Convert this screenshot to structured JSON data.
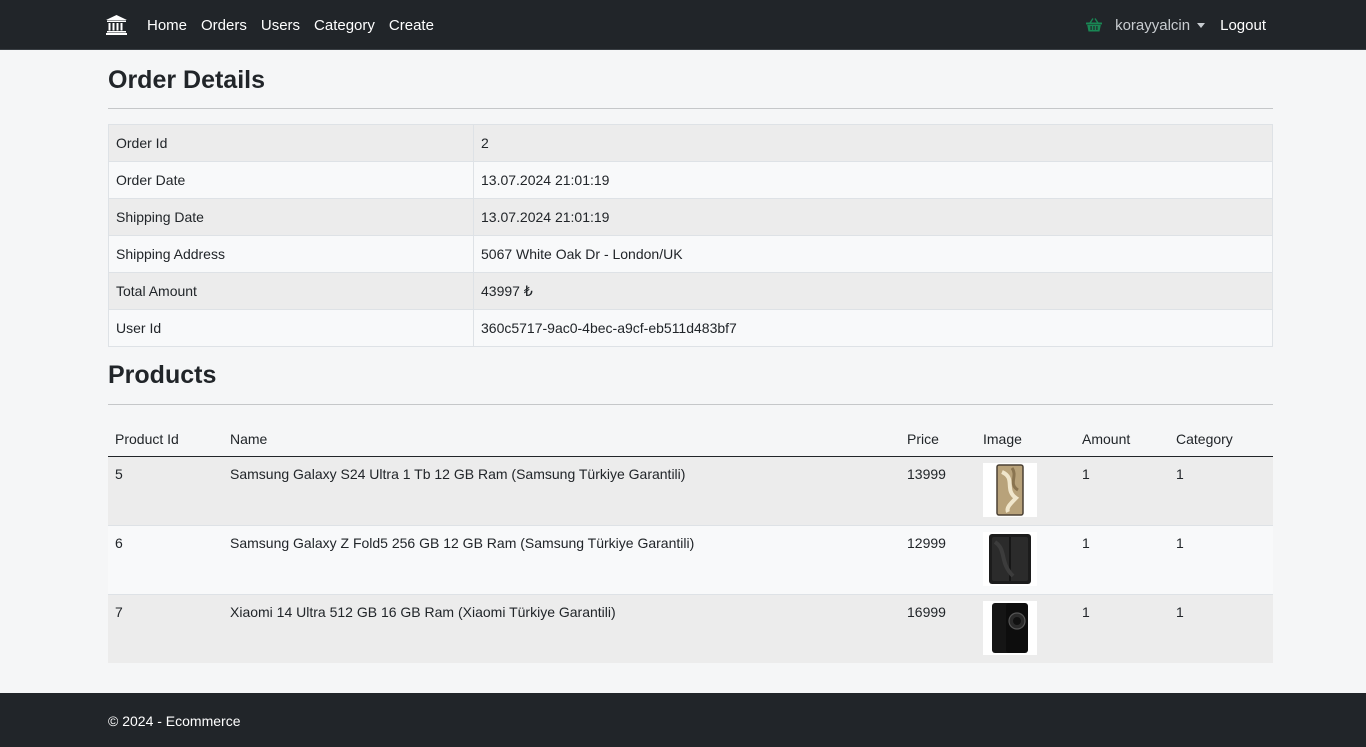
{
  "nav": {
    "brand_icon": "bank-icon",
    "links": [
      {
        "label": "Home"
      },
      {
        "label": "Orders"
      },
      {
        "label": "Users"
      },
      {
        "label": "Category"
      },
      {
        "label": "Create"
      }
    ],
    "basket_icon": "basket-icon",
    "username": "korayyalcin",
    "logout_label": "Logout"
  },
  "order": {
    "title": "Order Details",
    "rows": [
      {
        "label": "Order Id",
        "value": "2"
      },
      {
        "label": "Order Date",
        "value": "13.07.2024 21:01:19"
      },
      {
        "label": "Shipping Date",
        "value": "13.07.2024 21:01:19"
      },
      {
        "label": "Shipping Address",
        "value": "5067 White Oak Dr - London/UK"
      },
      {
        "label": "Total Amount",
        "value": "43997 ₺"
      },
      {
        "label": "User Id",
        "value": "360c5717-9ac0-4bec-a9cf-eb511d483bf7"
      }
    ]
  },
  "products": {
    "title": "Products",
    "headers": {
      "id": "Product Id",
      "name": "Name",
      "price": "Price",
      "image": "Image",
      "amount": "Amount",
      "category": "Category"
    },
    "rows": [
      {
        "id": "5",
        "name": "Samsung Galaxy S24 Ultra 1 Tb 12 GB Ram (Samsung Türkiye Garantili)",
        "price": "13999",
        "amount": "1",
        "category": "1"
      },
      {
        "id": "6",
        "name": "Samsung Galaxy Z Fold5 256 GB 12 GB Ram (Samsung Türkiye Garantili)",
        "price": "12999",
        "amount": "1",
        "category": "1"
      },
      {
        "id": "7",
        "name": "Xiaomi 14 Ultra 512 GB 16 GB Ram (Xiaomi Türkiye Garantili)",
        "price": "16999",
        "amount": "1",
        "category": "1"
      }
    ]
  },
  "footer": {
    "text": "© 2024 - Ecommerce"
  },
  "colors": {
    "navbar": "#212529",
    "basket": "#198754",
    "page_bg": "#f5f6f7"
  }
}
